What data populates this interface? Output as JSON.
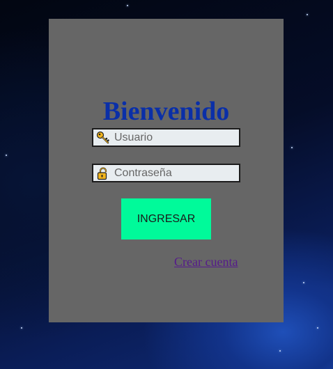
{
  "login": {
    "title": "Bienvenido",
    "username": {
      "placeholder": "Usuario",
      "value": "",
      "icon": "key-icon"
    },
    "password": {
      "placeholder": "Contraseña",
      "value": "",
      "icon": "lock-icon"
    },
    "submit_label": "INGRESAR",
    "create_account_label": "Crear cuenta"
  },
  "colors": {
    "panel": "#666666",
    "title": "#0a2fa8",
    "button": "#00fa9a",
    "link": "#551a8b",
    "field": "#e8edf0"
  }
}
